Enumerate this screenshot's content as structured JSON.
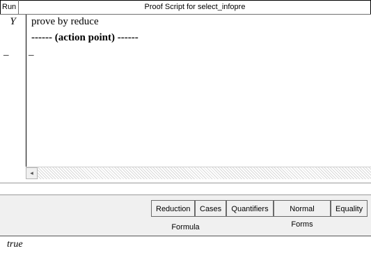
{
  "header": {
    "run_label": "Run",
    "title": "Proof Script for select_infopre"
  },
  "run_marks": [
    "Y",
    "–"
  ],
  "script": {
    "lines": [
      "prove by reduce",
      "------ (action point) ------",
      "–"
    ]
  },
  "buttons": {
    "reduction": "Reduction",
    "cases": "Cases",
    "quantifiers": "Quantifiers",
    "normal_forms": "Normal Forms",
    "equality": "Equality"
  },
  "formula": {
    "label": "Formula",
    "value": "true"
  },
  "scrollbar": {
    "left_arrow": "◂"
  }
}
